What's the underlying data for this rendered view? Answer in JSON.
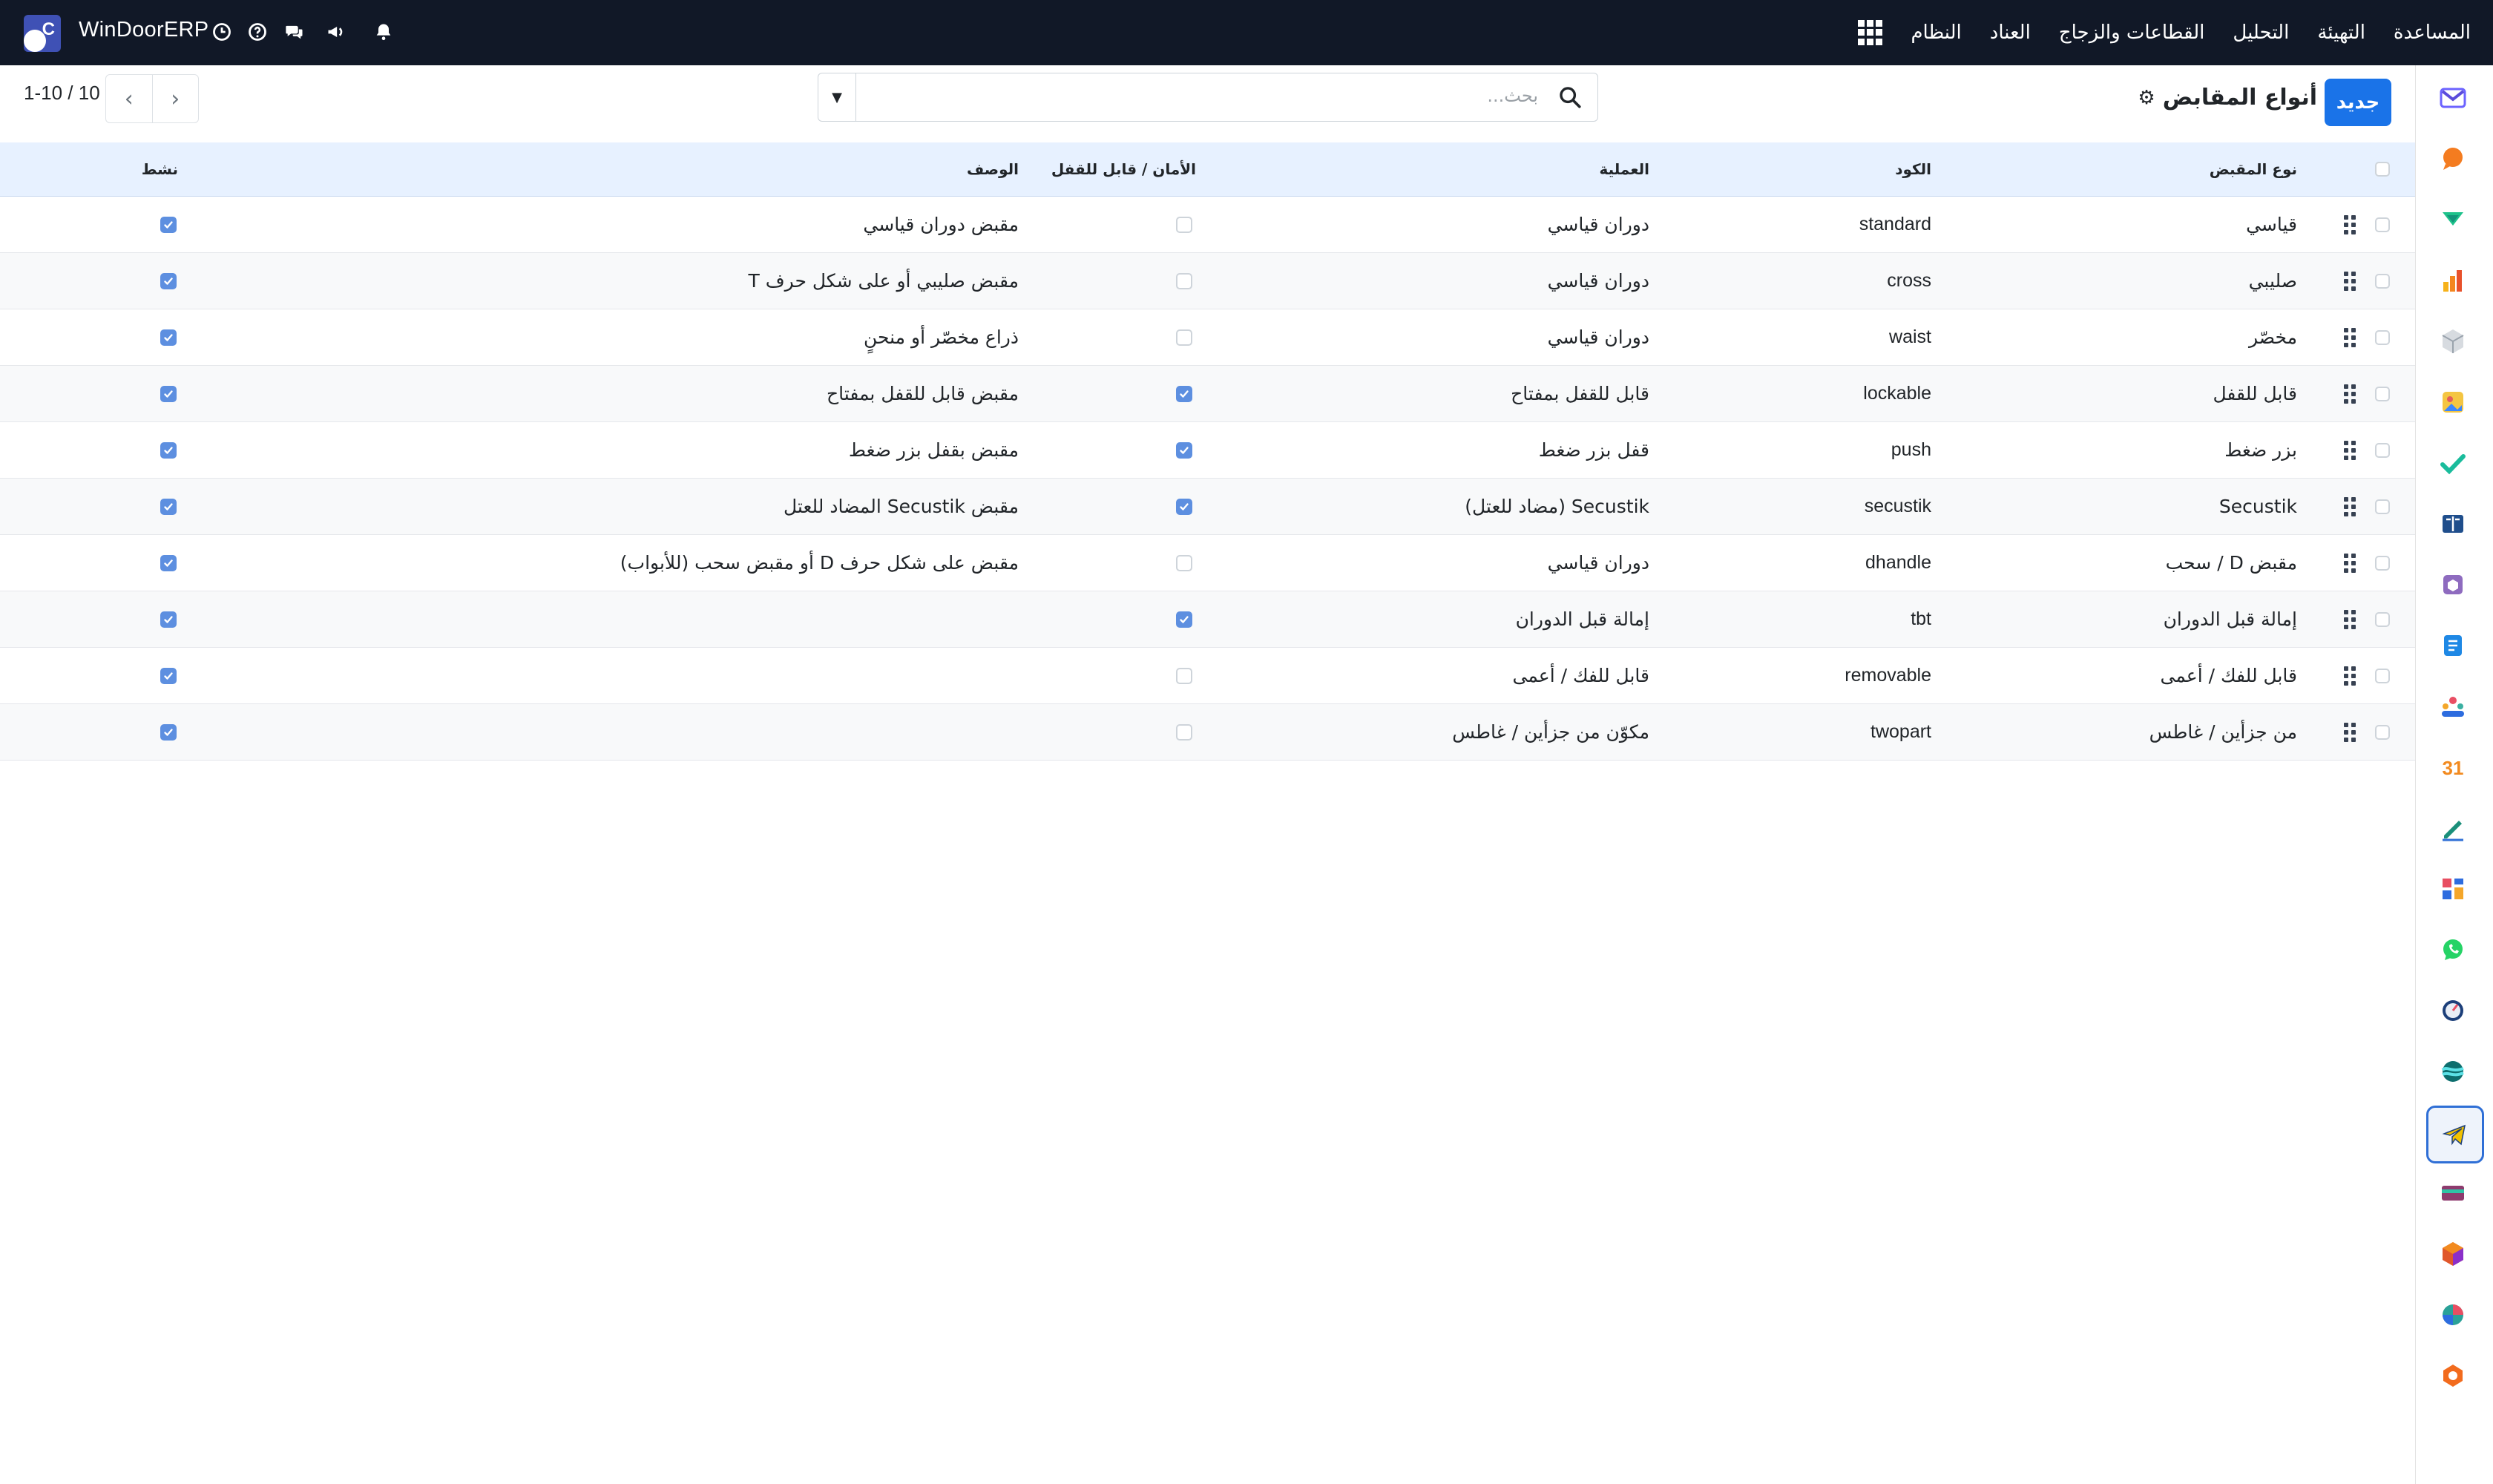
{
  "navbar": {
    "brand": "WinDoorERP",
    "menu": [
      "النظام",
      "العناد",
      "القطاعات والزجاج",
      "التحليل",
      "التهيئة",
      "المساعدة"
    ]
  },
  "control_panel": {
    "new_button": "جديد",
    "title": "أنواع المقابض",
    "search_placeholder": "بحث...",
    "pager_range": "1-10",
    "pager_total": "10"
  },
  "table": {
    "headers": {
      "handle_type": "نوع المقبض",
      "code": "الكود",
      "operation": "العملية",
      "safety": "الأمان / قابل للقفل",
      "description": "الوصف",
      "active": "نشط"
    },
    "rows": [
      {
        "name": "قياسي",
        "code": "standard",
        "operation": "دوران قياسي",
        "lockable": false,
        "description": "مقبض دوران قياسي",
        "active": true
      },
      {
        "name": "صليبي",
        "code": "cross",
        "operation": "دوران قياسي",
        "lockable": false,
        "description": "مقبض صليبي أو على شكل حرف T",
        "active": true
      },
      {
        "name": "مخصّر",
        "code": "waist",
        "operation": "دوران قياسي",
        "lockable": false,
        "description": "ذراع مخصّر أو منحنٍ",
        "active": true
      },
      {
        "name": "قابل للقفل",
        "code": "lockable",
        "operation": "قابل للقفل بمفتاح",
        "lockable": true,
        "description": "مقبض قابل للقفل بمفتاح",
        "active": true
      },
      {
        "name": "بزر ضغط",
        "code": "push",
        "operation": "قفل بزر ضغط",
        "lockable": true,
        "description": "مقبض بقفل بزر ضغط",
        "active": true
      },
      {
        "name": "Secustik",
        "code": "secustik",
        "operation": "Secustik (مضاد للعتل)",
        "lockable": true,
        "description": "مقبض Secustik المضاد للعتل",
        "active": true
      },
      {
        "name": "مقبض D / سحب",
        "code": "dhandle",
        "operation": "دوران قياسي",
        "lockable": false,
        "description": "مقبض على شكل حرف D أو مقبض سحب (للأبواب)",
        "active": true
      },
      {
        "name": "إمالة قبل الدوران",
        "code": "tbt",
        "operation": "إمالة قبل الدوران",
        "lockable": true,
        "description": "",
        "active": true
      },
      {
        "name": "قابل للفك / أعمى",
        "code": "removable",
        "operation": "قابل للفك / أعمى",
        "lockable": false,
        "description": "",
        "active": true
      },
      {
        "name": "من جزأين / غاطس",
        "code": "twopart",
        "operation": "مكوّن من جزأين / غاطس",
        "lockable": false,
        "description": "",
        "active": true
      }
    ]
  },
  "app_rail": {
    "apps": [
      "gmail-app",
      "chat-bubble-app",
      "stripe-app",
      "bar-chart-app",
      "box-app",
      "photo-app",
      "check-app",
      "book-app",
      "package-app",
      "note-app",
      "people-app",
      "calendar-app",
      "pencil-app",
      "dashboard-app",
      "whatsapp-app",
      "compass-app",
      "wave-app",
      "telegram-app",
      "card-app",
      "hexagon-app",
      "pie-app",
      "gem-app"
    ],
    "calendar_label": "31",
    "active_app": "telegram-app"
  },
  "colors": {
    "navbar_bg": "#111827",
    "primary": "#1a73e8",
    "header_bg": "#e7f1ff",
    "checkbox_on": "#5d8fe0"
  }
}
